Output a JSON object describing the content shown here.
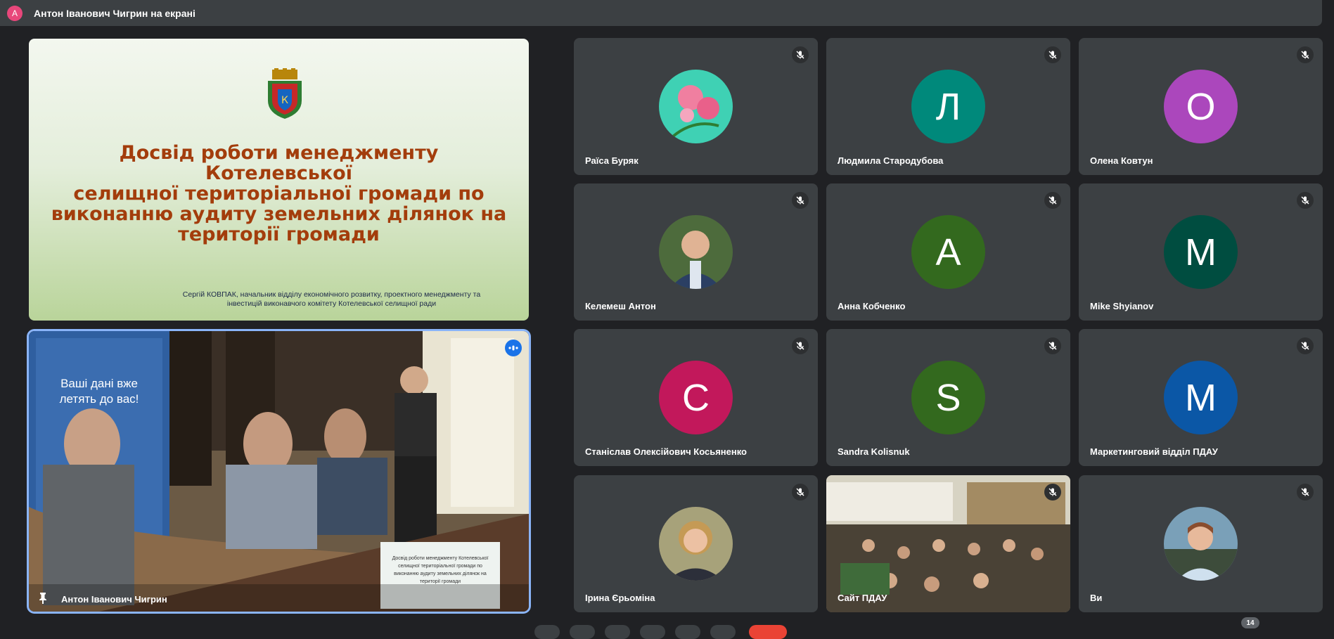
{
  "topbar": {
    "avatar_letter": "А",
    "title": "Антон Іванович Чигрин на екрані"
  },
  "slide": {
    "title_lines": [
      "Досвід роботи менеджменту Котелевської",
      "селищної територіальної громади по",
      "виконанню аудиту земельних ділянок на",
      "території громади"
    ],
    "author_lines": [
      "Сергій КОВПАК, начальник відділу економічного розвитку, проектного менеджменту та",
      "інвестицій виконавчого комітету Котелевської селищної ради"
    ]
  },
  "speaker": {
    "name": "Антон Іванович Чигрин",
    "banner_lines": [
      "Ваші дані вже",
      "летять до вас!"
    ],
    "table_sign_lines": [
      "Досвід роботи менеджменту Котелевської",
      "селищної територіальної громади по",
      "виконанню аудиту земельних ділянок на",
      "території громади"
    ]
  },
  "tiles": [
    {
      "name": "Раїса Буряк",
      "avatar": "photo",
      "photo_kind": "flower"
    },
    {
      "name": "Людмила Стародубова",
      "avatar": "letter",
      "letter": "Л",
      "color": "#00897b"
    },
    {
      "name": "Олена Ковтун",
      "avatar": "letter",
      "letter": "О",
      "color": "#ab47bc"
    },
    {
      "name": "Келемеш Антон",
      "avatar": "photo",
      "photo_kind": "man"
    },
    {
      "name": "Анна Кобченко",
      "avatar": "letter",
      "letter": "А",
      "color": "#33691e"
    },
    {
      "name": "Mike Shyianov",
      "avatar": "letter",
      "letter": "M",
      "color": "#004d40"
    },
    {
      "name": "Станіслав Олексійович Косьяненко",
      "avatar": "letter",
      "letter": "С",
      "color": "#c2185b"
    },
    {
      "name": "Sandra Kolisnuk",
      "avatar": "letter",
      "letter": "S",
      "color": "#33691e"
    },
    {
      "name": "Маркетинговий відділ ПДАУ",
      "avatar": "letter",
      "letter": "М",
      "color": "#0b57a6"
    },
    {
      "name": "Ірина Єрьоміна",
      "avatar": "photo",
      "photo_kind": "woman"
    },
    {
      "name": "Сайт ПДАУ",
      "avatar": "video",
      "photo_kind": "room"
    },
    {
      "name": "Ви",
      "avatar": "photo",
      "photo_kind": "woman2"
    }
  ],
  "participant_count": "14",
  "icons": {
    "mic_off": "mic-off-icon",
    "pin": "pin-icon",
    "speaking": "speaking-icon"
  }
}
